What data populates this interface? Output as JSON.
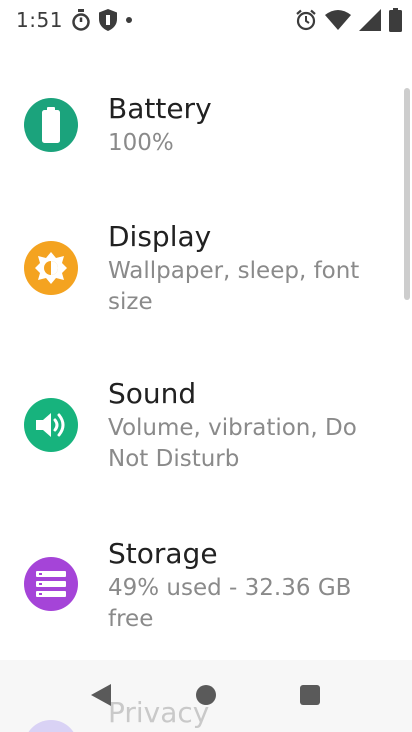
{
  "status_bar": {
    "time": "1:51"
  },
  "settings": {
    "items": [
      {
        "title": "Battery",
        "subtitle": "100%",
        "icon": "battery-icon",
        "color": "#1ba37c"
      },
      {
        "title": "Display",
        "subtitle": "Wallpaper, sleep, font size",
        "icon": "brightness-icon",
        "color": "#f4a320"
      },
      {
        "title": "Sound",
        "subtitle": "Volume, vibration, Do Not Disturb",
        "icon": "volume-icon",
        "color": "#17b37d"
      },
      {
        "title": "Storage",
        "subtitle": "49% used - 32.36 GB free",
        "icon": "storage-icon",
        "color": "#a544d8"
      },
      {
        "title": "Privacy",
        "icon": "privacy-icon"
      }
    ]
  },
  "nav": {
    "back": "back-icon",
    "home": "home-icon",
    "recents": "recents-icon"
  }
}
